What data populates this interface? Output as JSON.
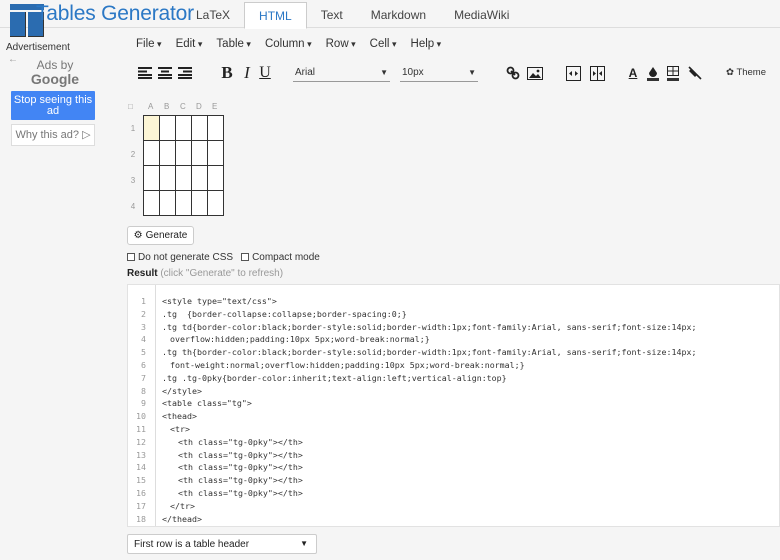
{
  "app": {
    "title": "Tables Generator",
    "tabs": [
      "LaTeX",
      "HTML",
      "Text",
      "Markdown",
      "MediaWiki"
    ],
    "active_tab": "HTML"
  },
  "ad": {
    "label": "Advertisement",
    "ads_by": "Ads by",
    "google": "Google",
    "stop": "Stop seeing this ad",
    "why": "Why this ad? ▷"
  },
  "menu": [
    "File",
    "Edit",
    "Table",
    "Column",
    "Row",
    "Cell",
    "Help"
  ],
  "toolbar": {
    "font": "Arial",
    "size": "10px",
    "theme": "Theme",
    "icons": [
      "align-left-icon",
      "align-center-icon",
      "align-right-icon",
      "bold-icon",
      "italic-icon",
      "underline-icon",
      "link-icon",
      "image-icon",
      "merge-cells-icon",
      "split-cells-icon",
      "text-color-icon",
      "fill-color-icon",
      "border-icon",
      "clear-format-icon",
      "theme-icon"
    ]
  },
  "grid": {
    "columns": [
      "A",
      "B",
      "C",
      "D",
      "E"
    ],
    "rows": [
      "1",
      "2",
      "3",
      "4"
    ],
    "selected": [
      0,
      0
    ]
  },
  "generate": "Generate",
  "options": {
    "no_css": "Do not generate CSS",
    "compact": "Compact mode"
  },
  "result": {
    "label": "Result",
    "hint": "(click \"Generate\" to refresh)"
  },
  "code": [
    {
      "n": "1",
      "indent": 0,
      "text": "<style type=\"text/css\">"
    },
    {
      "n": "2",
      "indent": 0,
      "text": ".tg  {border-collapse:collapse;border-spacing:0;}"
    },
    {
      "n": "3",
      "indent": 0,
      "text": ".tg td{border-color:black;border-style:solid;border-width:1px;font-family:Arial, sans-serif;font-size:14px;"
    },
    {
      "n": "4",
      "indent": 1,
      "text": "overflow:hidden;padding:10px 5px;word-break:normal;}"
    },
    {
      "n": "5",
      "indent": 0,
      "text": ".tg th{border-color:black;border-style:solid;border-width:1px;font-family:Arial, sans-serif;font-size:14px;"
    },
    {
      "n": "6",
      "indent": 1,
      "text": "font-weight:normal;overflow:hidden;padding:10px 5px;word-break:normal;}"
    },
    {
      "n": "7",
      "indent": 0,
      "text": ".tg .tg-0pky{border-color:inherit;text-align:left;vertical-align:top}"
    },
    {
      "n": "8",
      "indent": 0,
      "text": "</style>"
    },
    {
      "n": "9",
      "indent": 0,
      "text": "<table class=\"tg\">"
    },
    {
      "n": "10",
      "indent": 0,
      "text": "<thead>"
    },
    {
      "n": "11",
      "indent": 1,
      "text": "<tr>"
    },
    {
      "n": "12",
      "indent": 2,
      "text": "<th class=\"tg-0pky\"></th>"
    },
    {
      "n": "13",
      "indent": 2,
      "text": "<th class=\"tg-0pky\"></th>"
    },
    {
      "n": "14",
      "indent": 2,
      "text": "<th class=\"tg-0pky\"></th>"
    },
    {
      "n": "15",
      "indent": 2,
      "text": "<th class=\"tg-0pky\"></th>"
    },
    {
      "n": "16",
      "indent": 2,
      "text": "<th class=\"tg-0pky\"></th>"
    },
    {
      "n": "17",
      "indent": 1,
      "text": "</tr>"
    },
    {
      "n": "18",
      "indent": 0,
      "text": "</thead>"
    }
  ],
  "footer_select": "First row is a table header"
}
